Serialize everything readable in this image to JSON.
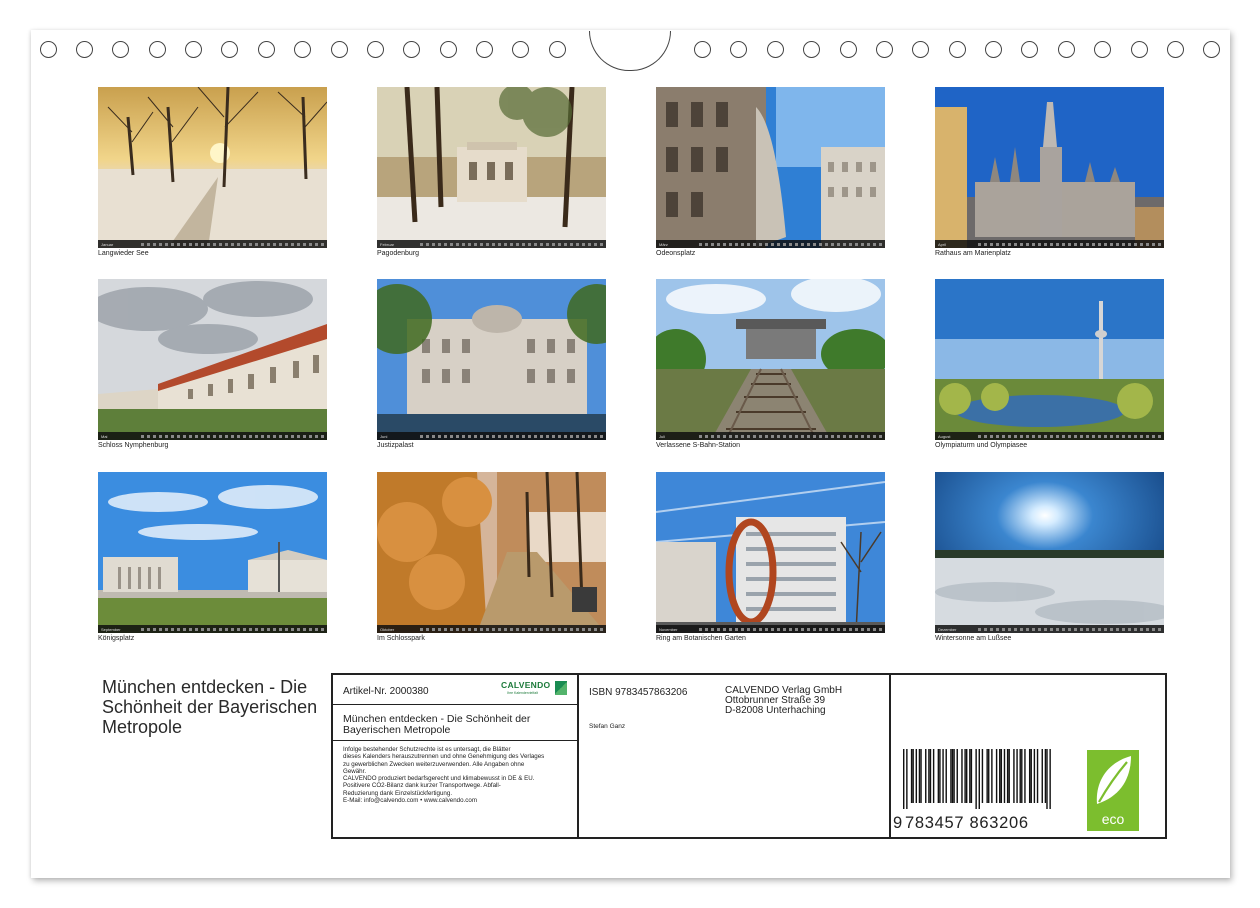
{
  "calendar": {
    "title": "München entdecken - Die Schönheit der Bayerischen Metropole"
  },
  "months": [
    {
      "month": "Januar",
      "caption": "Langwieder See"
    },
    {
      "month": "Februar",
      "caption": "Pagodenburg"
    },
    {
      "month": "März",
      "caption": "Odeonsplatz"
    },
    {
      "month": "April",
      "caption": "Rathaus am Marienplatz"
    },
    {
      "month": "Mai",
      "caption": "Schloss Nymphenburg"
    },
    {
      "month": "Juni",
      "caption": "Justizpalast"
    },
    {
      "month": "Juli",
      "caption": "Verlassene S-Bahn-Station"
    },
    {
      "month": "August",
      "caption": "Olympiaturm und Olympiasee"
    },
    {
      "month": "September",
      "caption": "Königsplatz"
    },
    {
      "month": "Oktober",
      "caption": "Im Schlosspark"
    },
    {
      "month": "November",
      "caption": "Ring am Botanischen Garten"
    },
    {
      "month": "Dezember",
      "caption": "Wintersonne am Lußsee"
    }
  ],
  "info": {
    "article_no": "Artikel-Nr. 2000380",
    "brand": "CALVENDO",
    "brand_sub": "Ihre Kalendervielfalt",
    "subtitle": "München entdecken - Die Schönheit der Bayerischen Metropole",
    "legal": [
      "Infolge bestehender Schutzrechte ist es untersagt, die Blätter",
      "dieses Kalenders herauszutrennen und ohne Genehmigung des Verlages",
      "zu gewerblichen Zwecken weiterzuverwenden. Alle Angaben ohne",
      "Gewähr.",
      "CALVENDO produziert bedarfsgerecht und klimabewusst in DE & EU.",
      "Positivere CO2-Bilanz dank kurzer Transportwege. Abfall-",
      "Reduzierung dank Einzelstückfertigung.",
      "E-Mail: info@calvendo.com • www.calvendo.com"
    ],
    "isbn": "ISBN 9783457863206",
    "author": "Stefan Ganz",
    "publisher": [
      "CALVENDO Verlag GmbH",
      "Ottobrunner Straße 39",
      "D-82008 Unterhaching"
    ],
    "barcode_lead": "9",
    "barcode_digits": "783457 863206",
    "eco_label": "eco"
  }
}
